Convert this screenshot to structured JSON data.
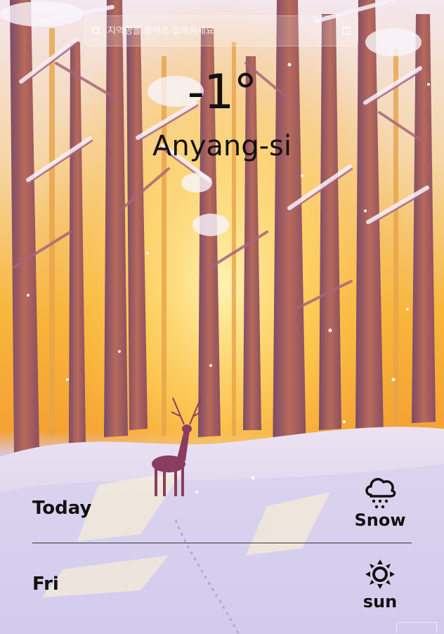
{
  "search": {
    "placeholder": "지역명을 영어로 입력하세요",
    "icon_left": "search-icon",
    "icon_right": "location-icon"
  },
  "current": {
    "temperature": "-1°",
    "city": "Anyang-si"
  },
  "forecast": [
    {
      "day": "Today",
      "condition": "Snow",
      "icon": "cloud-snow-icon"
    },
    {
      "day": "Fri",
      "condition": "sun",
      "icon": "sun-icon"
    }
  ],
  "colors": {
    "text": "#111111",
    "sky_glow": "#f6b93a",
    "snow": "#e8dff0"
  }
}
